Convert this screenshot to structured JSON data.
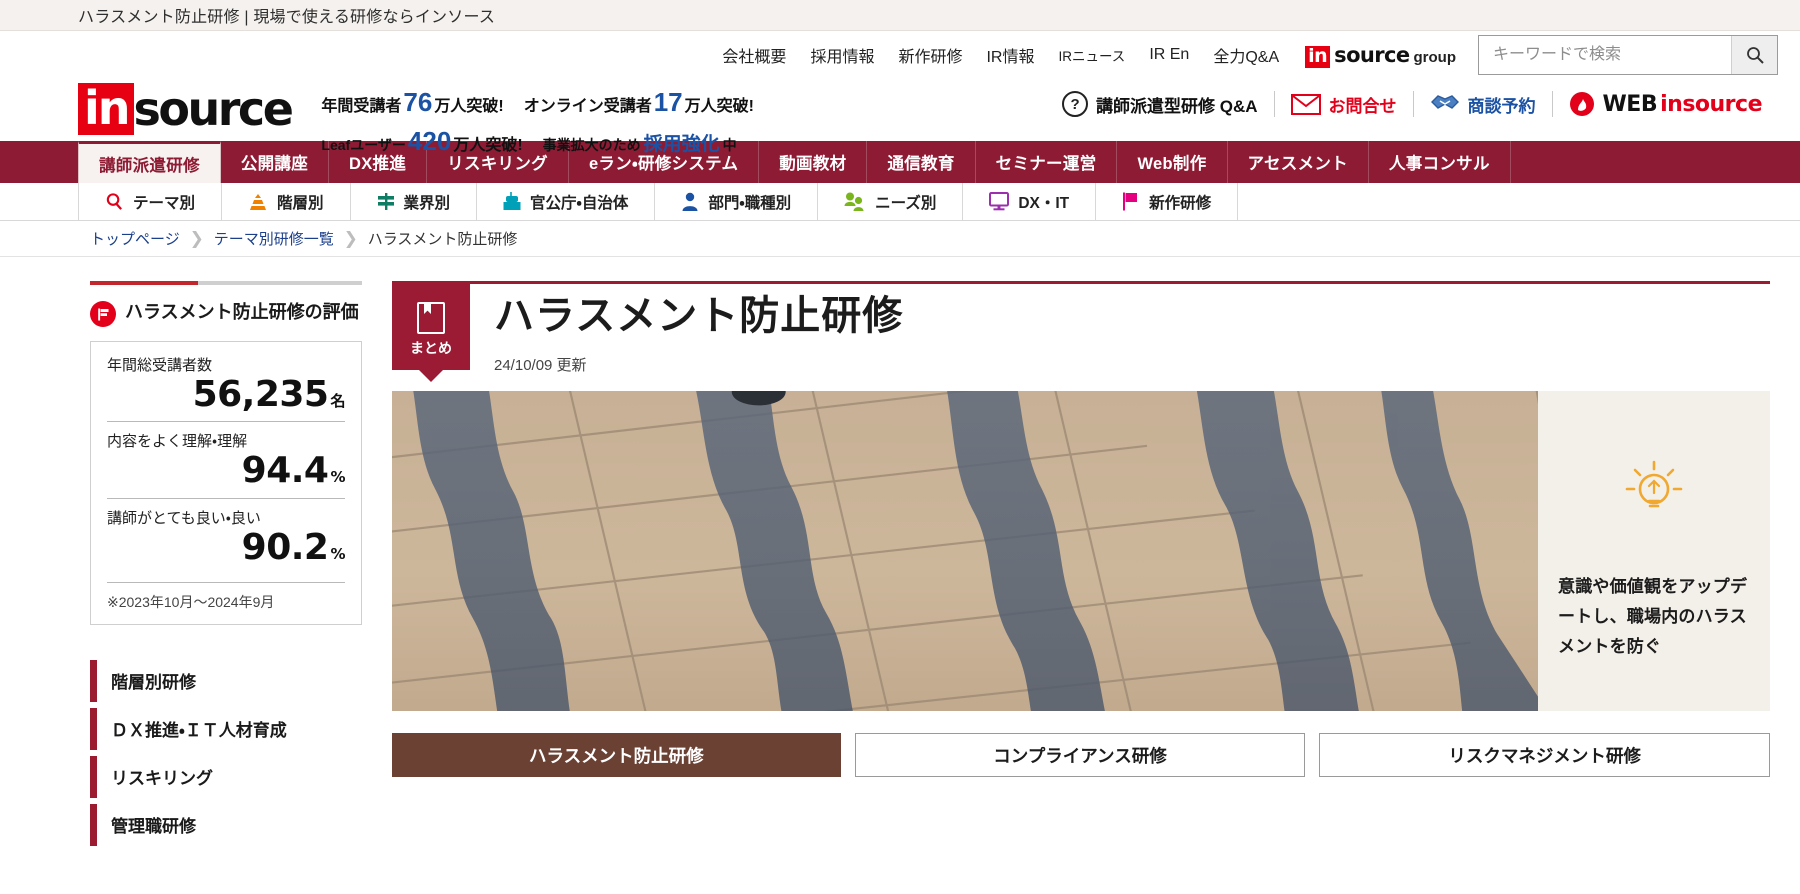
{
  "browser": {
    "tab_title": "ハラスメント防止研修 | 現場で使える研修ならインソース"
  },
  "top_utility": {
    "links": [
      {
        "label": "会社概要"
      },
      {
        "label": "採用情報"
      },
      {
        "label": "新作研修"
      },
      {
        "label": "IR情報"
      },
      {
        "label": "IRニュース"
      },
      {
        "label": "IR En"
      },
      {
        "label": "全力Q&A"
      }
    ],
    "group_logo": {
      "mark": "in",
      "word": "source",
      "suffix": "group"
    },
    "search": {
      "placeholder": "キーワードで検索",
      "value": "",
      "icon": "search-icon"
    }
  },
  "brand": {
    "logo_mark": "in",
    "logo_word": "source",
    "catch_line_1": {
      "a": "年間受講者",
      "num1": "76",
      "b": "万人突破!",
      "c": "オンライン受講者",
      "num2": "17",
      "d": "万人突破!"
    },
    "catch_line_2": {
      "a": "Leafユーザー",
      "num1": "420",
      "b": "万人突破!",
      "c": "事業拡大のため",
      "hl": "採用強化",
      "d": "中"
    }
  },
  "header_actions": [
    {
      "label": "講師派遣型研修 Q&A",
      "icon": "question-mark-icon",
      "style": "dark"
    },
    {
      "label": "お問合せ",
      "icon": "mail-icon",
      "style": "red"
    },
    {
      "label": "商談予約",
      "icon": "handshake-icon",
      "style": "blue"
    },
    {
      "label_a": "WEB",
      "label_b": "insource",
      "icon": "web-insource-icon",
      "style": "webinsource"
    }
  ],
  "main_nav": {
    "tabs": [
      {
        "label": "講師派遣研修",
        "active": true
      },
      {
        "label": "公開講座",
        "active": false
      },
      {
        "label": "DX推進",
        "active": false
      },
      {
        "label": "リスキリング",
        "active": false
      },
      {
        "label": "eラン・研修システム",
        "active": false
      },
      {
        "label": "動画教材",
        "active": false
      },
      {
        "label": "通信教育",
        "active": false
      },
      {
        "label": "セミナー運営",
        "active": false
      },
      {
        "label": "Web制作",
        "active": false
      },
      {
        "label": "アセスメント",
        "active": false
      },
      {
        "label": "人事コンサル",
        "active": false
      }
    ]
  },
  "sub_nav": {
    "items": [
      {
        "label": "テーマ別",
        "icon": "magnifier-icon",
        "color": "#e2001a"
      },
      {
        "label": "階層別",
        "icon": "pyramid-icon",
        "color": "#f08100"
      },
      {
        "label": "業界別",
        "icon": "signpost-icon",
        "color": "#0f7d63"
      },
      {
        "label": "官公庁・自治体",
        "icon": "building-icon",
        "color": "#00a0b8"
      },
      {
        "label": "部門・職種別",
        "icon": "person-icon",
        "color": "#1b52a4"
      },
      {
        "label": "ニーズ別",
        "icon": "people-idea-icon",
        "color": "#7ab51d"
      },
      {
        "label": "DX・IT",
        "icon": "monitor-icon",
        "color": "#9b2fae"
      },
      {
        "label": "新作研修",
        "icon": "flag-icon",
        "color": "#e4007f"
      }
    ]
  },
  "breadcrumb": {
    "items": [
      {
        "label": "トップページ",
        "current": false
      },
      {
        "label": "テーマ別研修一覧",
        "current": false
      },
      {
        "label": "ハラスメント防止研修",
        "current": true
      }
    ]
  },
  "sidebar": {
    "eval_heading": "ハラスメント防止研修の評価",
    "eval_icon": "flag-badge-icon",
    "stats": [
      {
        "label": "年間総受講者数",
        "value": "56,235",
        "unit": "名"
      },
      {
        "label": "内容をよく理解・理解",
        "value": "94.4",
        "unit": "%"
      },
      {
        "label": "講師がとても良い・良い",
        "value": "90.2",
        "unit": "%"
      }
    ],
    "note": "※2023年10月～2024年9月",
    "menu": [
      {
        "label": "階層別研修"
      },
      {
        "label": "ＤＸ推進・ＩＴ人材育成"
      },
      {
        "label": "リスキリング"
      },
      {
        "label": "管理職研修"
      }
    ]
  },
  "content": {
    "tag": {
      "label": "まとめ",
      "icon": "book-icon"
    },
    "title": "ハラスメント防止研修",
    "updated": "24/10/09 更新",
    "hero": {
      "image_alt": "歩行者の影が映る歩道の写真",
      "side_icon": "lightbulb-idea-icon",
      "side_copy": "意識や価値観をアップデートし、職場内のハラスメントを防ぐ"
    },
    "buttons": [
      {
        "label": "ハラスメント防止研修",
        "active": true
      },
      {
        "label": "コンプライアンス研修",
        "active": false
      },
      {
        "label": "リスクマネジメント研修",
        "active": false
      }
    ]
  },
  "colors": {
    "brand_red": "#e60012",
    "nav_maroon": "#8e1b34",
    "accent_blue": "#1b52a4",
    "button_brown": "#6b4134",
    "panel_beige": "#f3efe9"
  }
}
